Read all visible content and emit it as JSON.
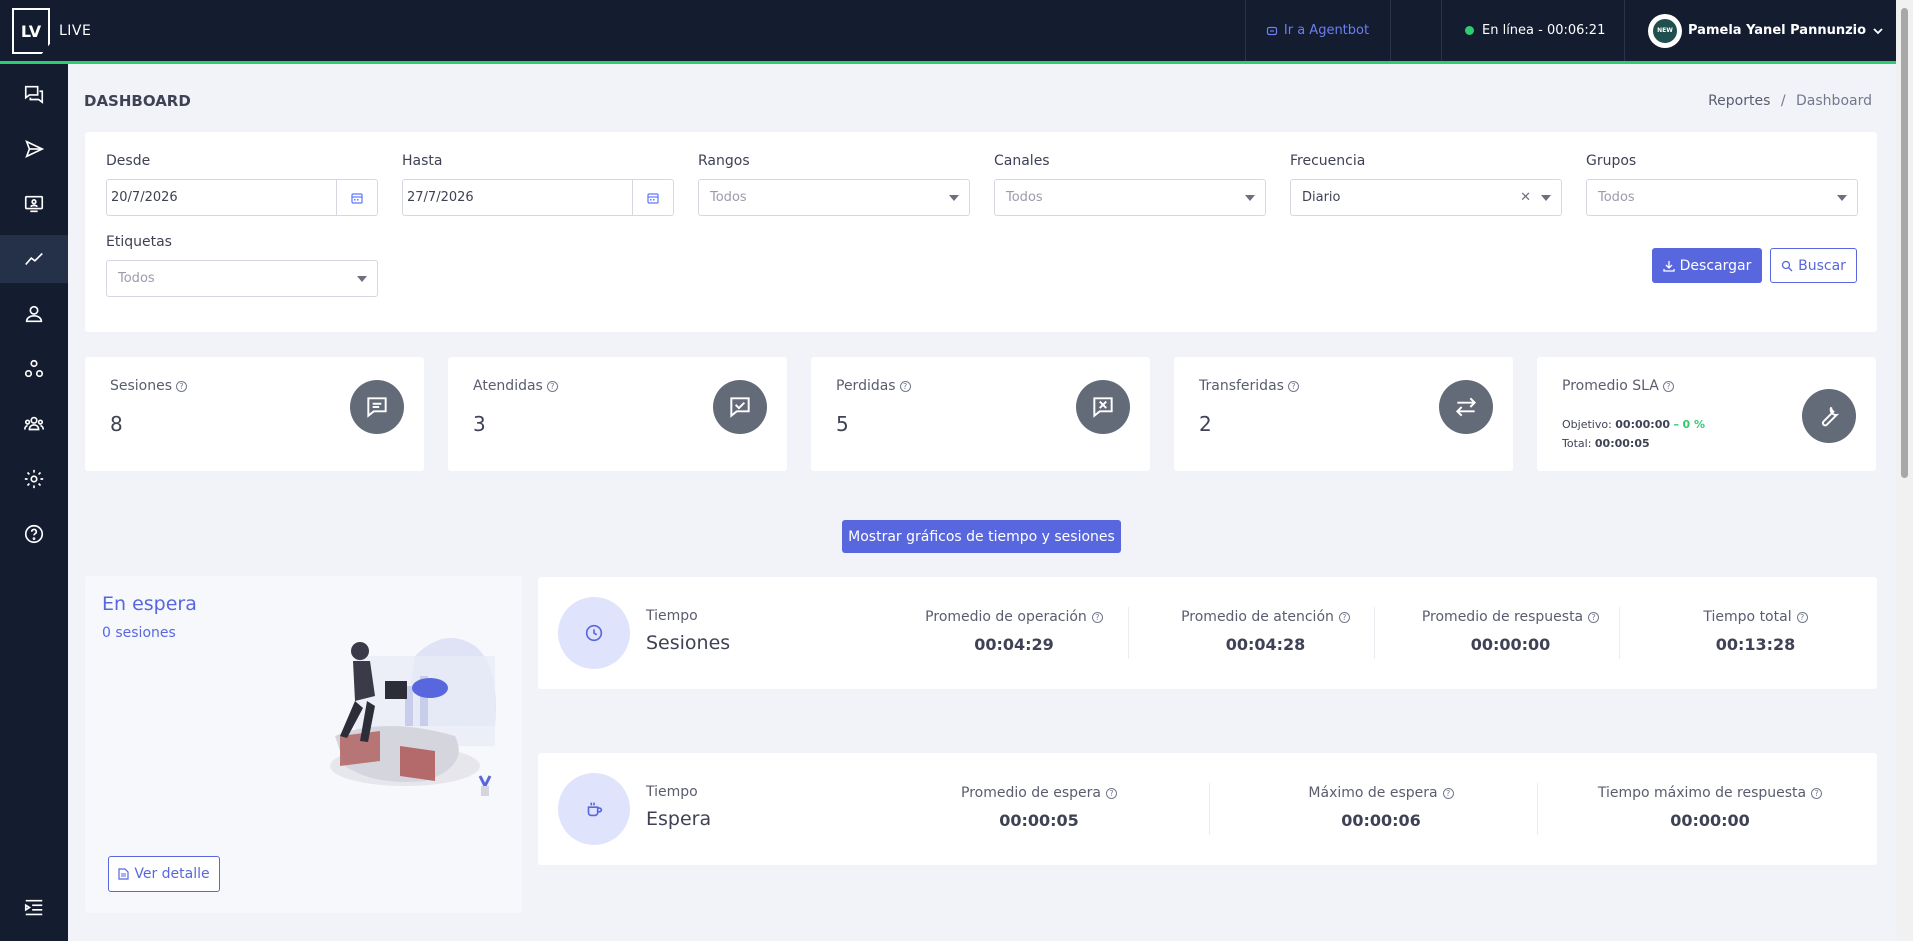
{
  "app": {
    "logo": "LV",
    "name": "LIVE"
  },
  "topbar": {
    "agentbot_label": "Ir a Agentbot",
    "status_label": "En línea - 00:06:21",
    "user_name": "Pamela Yanel Pannunzio",
    "avatar_text": "NEW"
  },
  "sidebar": {
    "items": [
      {
        "icon": "chat-icon"
      },
      {
        "icon": "send-icon"
      },
      {
        "icon": "monitor-icon"
      },
      {
        "icon": "chart-line-icon",
        "active": true
      },
      {
        "icon": "user-icon"
      },
      {
        "icon": "nodes-icon"
      },
      {
        "icon": "users-icon"
      },
      {
        "icon": "gear-icon"
      },
      {
        "icon": "help-icon"
      },
      {
        "icon": "collapse-menu-icon"
      }
    ]
  },
  "page": {
    "title": "DASHBOARD",
    "breadcrumb": {
      "parent": "Reportes",
      "separator": "/",
      "current": "Dashboard"
    }
  },
  "filters": {
    "desde": {
      "label": "Desde",
      "value": "20/7/2026"
    },
    "hasta": {
      "label": "Hasta",
      "value": "27/7/2026"
    },
    "rangos": {
      "label": "Rangos",
      "value": "Todos"
    },
    "canales": {
      "label": "Canales",
      "value": "Todos"
    },
    "frecuencia": {
      "label": "Frecuencia",
      "value": "Diario"
    },
    "grupos": {
      "label": "Grupos",
      "value": "Todos"
    },
    "etiquetas": {
      "label": "Etiquetas",
      "value": "Todos"
    },
    "download_label": "Descargar",
    "search_label": "Buscar"
  },
  "stats": {
    "sesiones": {
      "label": "Sesiones",
      "value": "8"
    },
    "atendidas": {
      "label": "Atendidas",
      "value": "3"
    },
    "perdidas": {
      "label": "Perdidas",
      "value": "5"
    },
    "transferidas": {
      "label": "Transferidas",
      "value": "2"
    },
    "sla": {
      "label": "Promedio SLA",
      "objetivo_label": "Objetivo:",
      "objetivo_value": "00:00:00",
      "dash": "–",
      "objetivo_pct": "0 %",
      "total_label": "Total:",
      "total_value": "00:00:05"
    }
  },
  "toggle_charts_label": "Mostrar gráficos de tiempo y sesiones",
  "waiting": {
    "title": "En espera",
    "subtitle": "0 sesiones",
    "detail_label": "Ver detalle"
  },
  "sessions_panel": {
    "label": "Tiempo",
    "name": "Sesiones",
    "metrics": [
      {
        "label": "Promedio de operación",
        "value": "00:04:29"
      },
      {
        "label": "Promedio de atención",
        "value": "00:04:28"
      },
      {
        "label": "Promedio de respuesta",
        "value": "00:00:00"
      },
      {
        "label": "Tiempo total",
        "value": "00:13:28"
      }
    ]
  },
  "wait_panel": {
    "label": "Tiempo",
    "name": "Espera",
    "metrics": [
      {
        "label": "Promedio de espera",
        "value": "00:00:05"
      },
      {
        "label": "Máximo de espera",
        "value": "00:00:06"
      },
      {
        "label": "Tiempo máximo de respuesta",
        "value": "00:00:00"
      }
    ]
  },
  "colors": {
    "topbar_bg": "#141c30",
    "accent": "#5867dd",
    "online": "#2ecc71",
    "stat_icon_bg": "#646b78"
  }
}
